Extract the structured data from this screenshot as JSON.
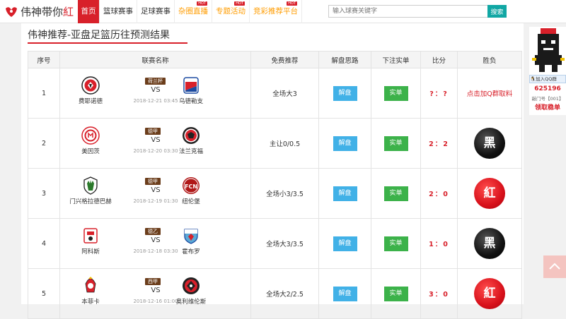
{
  "header": {
    "logo_main": "伟神带你",
    "logo_accent": "紅",
    "nav": [
      {
        "label": "首页",
        "active": true,
        "hot": false
      },
      {
        "label": "篮球赛事",
        "active": false,
        "hot": false
      },
      {
        "label": "足球赛事",
        "active": false,
        "hot": false
      },
      {
        "label": "杂圈直播",
        "active": false,
        "hot": true,
        "hot_text": "HOT"
      },
      {
        "label": "专题活动",
        "active": false,
        "hot": true,
        "hot_text": "HOT"
      },
      {
        "label": "竞彩推荐平台",
        "active": false,
        "hot": true,
        "hot_text": "HOT"
      }
    ],
    "search_placeholder": "输入球赛关键字",
    "search_button": "搜索"
  },
  "page": {
    "title": "伟神推荐-亚盘足篮历往预测结果"
  },
  "table": {
    "headers": [
      "序号",
      "联赛名称",
      "免费推荐",
      "解盘思路",
      "下注实单",
      "比分",
      "胜负"
    ],
    "analysis_label": "解盘",
    "bet_label": "实单",
    "vs": "VS",
    "rows": [
      {
        "no": "1",
        "home": "费耶诺德",
        "away": "乌德勒支",
        "league": "荷兰杯",
        "time": "2018-12-21 03:45",
        "tip": "全场大3",
        "score": "?：?",
        "result_text": "点击加Q群取料",
        "result_type": "link"
      },
      {
        "no": "2",
        "home": "美因茨",
        "away": "法兰克福",
        "league": "德甲",
        "time": "2018-12-20 03:30",
        "tip": "主让0/0.5",
        "score": "2：2",
        "result_text": "黑",
        "result_type": "black"
      },
      {
        "no": "3",
        "home": "门兴格拉德巴赫",
        "away": "纽伦堡",
        "league": "德甲",
        "time": "2018-12-19 01:30",
        "tip": "全场小3/3.5",
        "score": "2：0",
        "result_text": "紅",
        "result_type": "red"
      },
      {
        "no": "4",
        "home": "阿科斯",
        "away": "霍布罗",
        "league": "德乙",
        "time": "2018-12-18 03:30",
        "tip": "全场大3/3.5",
        "score": "1：0",
        "result_text": "黑",
        "result_type": "black"
      },
      {
        "no": "5",
        "home": "本菲卡",
        "away": "奥利维伦斯",
        "league": "西甲",
        "time": "2018-12-16 01:00",
        "tip": "全场大2/2.5",
        "score": "3：0",
        "result_text": "紅",
        "result_type": "red"
      }
    ]
  },
  "sidebar": {
    "qq_badge": "加入QQ群",
    "qq_number": "625196",
    "qq_sub": "敲门号【001】",
    "qq_get": "领取稳单"
  },
  "colors": {
    "brand_red": "#d8202a",
    "search_teal": "#11a7a4",
    "analysis_blue": "#41b1e7",
    "bet_green": "#3cb24a"
  }
}
